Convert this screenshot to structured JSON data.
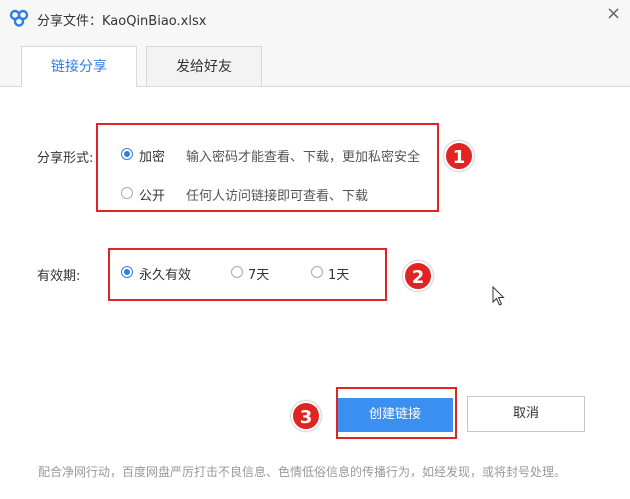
{
  "window": {
    "title": "分享文件：KaoQinBiao.xlsx",
    "close_glyph": "×"
  },
  "tabs": [
    {
      "label": "链接分享",
      "active": true
    },
    {
      "label": "发给好友",
      "active": false
    }
  ],
  "share_form": {
    "label": "分享形式:",
    "options": [
      {
        "label": "加密",
        "description": "输入密码才能查看、下载，更加私密安全",
        "selected": true
      },
      {
        "label": "公开",
        "description": "任何人访问链接即可查看、下载",
        "selected": false
      }
    ]
  },
  "validity": {
    "label": "有效期:",
    "options": [
      {
        "label": "永久有效",
        "selected": true
      },
      {
        "label": "7天",
        "selected": false
      },
      {
        "label": "1天",
        "selected": false
      }
    ]
  },
  "buttons": {
    "create": "创建链接",
    "cancel": "取消"
  },
  "annotations": [
    "1",
    "2",
    "3"
  ],
  "footer": "配合净网行动，百度网盘严厉打击不良信息、色情低俗信息的传播行为，如经发现，或将封号处理。",
  "colors": {
    "accent": "#2f7fe1",
    "highlight": "#e02424",
    "primary_button": "#3b8ff0"
  }
}
